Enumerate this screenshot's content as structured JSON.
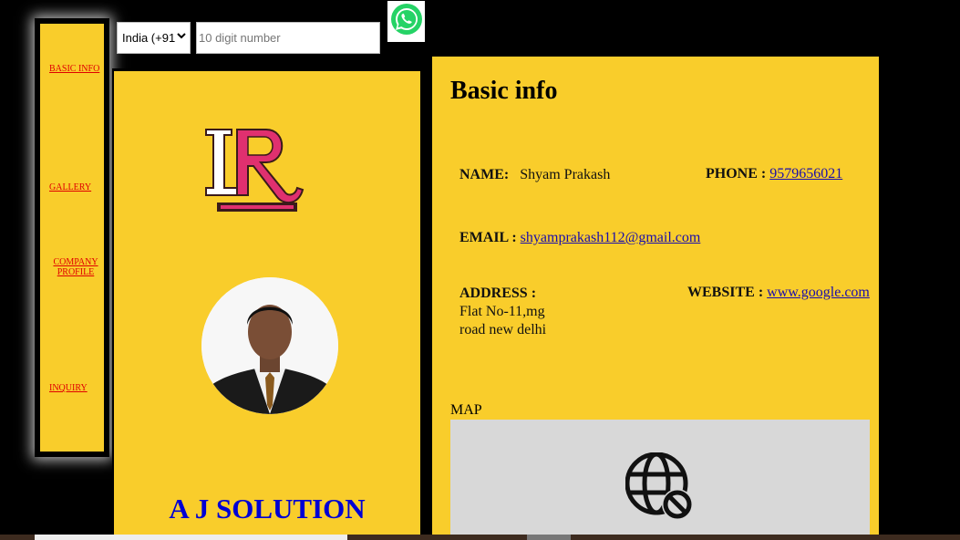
{
  "nav": {
    "basic_info": "BASIC INFO",
    "gallery": "GALLERY",
    "company_profile": "COMPANY PROFILE",
    "inquiry": "INQUIRY"
  },
  "share": {
    "country": "India (+91)",
    "phone_placeholder": "10 digit number"
  },
  "profile": {
    "company": "A J SOLUTION"
  },
  "basic_info": {
    "title": "Basic info",
    "name_label": "NAME:",
    "name": "Shyam Prakash",
    "phone_label": "PHONE :",
    "phone": "9579656021",
    "email_label": "EMAIL :",
    "email": "shyamprakash112@gmail.com",
    "address_label": "ADDRESS :",
    "address_line1": "Flat No-11,mg",
    "address_line2": "road new delhi",
    "website_label": "WEBSITE :",
    "website": "www.google.com",
    "map_label": "MAP"
  },
  "colors": {
    "card_bg": "#f9cd2b",
    "company_text": "#0000d4",
    "nav_link": "#e00000",
    "whatsapp": "#25d366"
  },
  "icons": [
    "whatsapp-icon",
    "chevron-down-icon",
    "globe-blocked-icon"
  ]
}
